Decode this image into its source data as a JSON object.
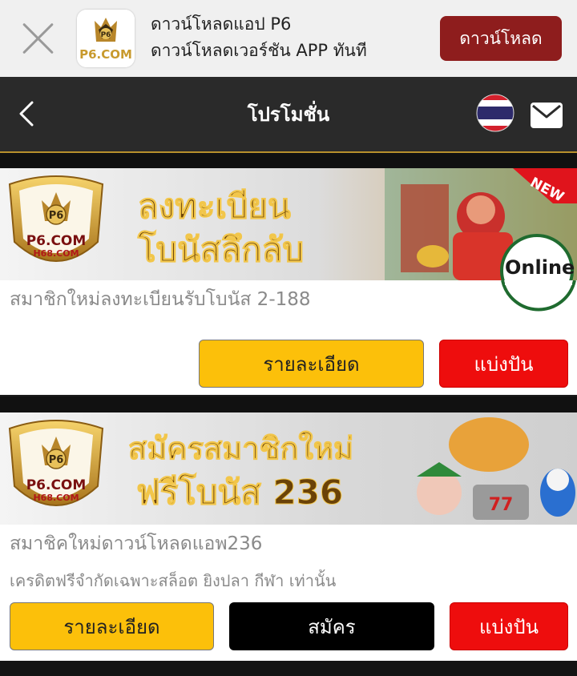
{
  "download_bar": {
    "line1": "ดาวน์โหลดแอป P6",
    "line2": "ดาวน์โหลดเวอร์ชัน APP ทันที",
    "button": "ดาวน์โหลด",
    "logo_text": "P6.COM"
  },
  "header": {
    "title": "โปรโมชั่น"
  },
  "promotions": [
    {
      "banner_headline_1": "ลงทะเบียน",
      "banner_headline_2": "โบนัสลึกลับ",
      "badge_new": "NEW",
      "badge_online": "Online",
      "brand_1": "P6.COM",
      "brand_2": "H68.COM",
      "title": "สมาชิกใหม่ลงทะเบียนรับโบนัส 2-188",
      "details_button": "รายละเอียด",
      "share_button": "แบ่งปัน"
    },
    {
      "banner_headline_1": "สมัครสมาชิกใหม่",
      "banner_headline_2": "ฟรีโบนัส 236",
      "brand_1": "P6.COM",
      "brand_2": "H68.COM",
      "title": "สมาชิคใหม่ดาวน์โหลดแอพ236",
      "subtitle": "เครดิตฟรีจำกัดเฉพาะสล็อต ยิงปลา กีฬา เท่านั้น",
      "details_button": "รายละเอียด",
      "register_button": "สมัคร",
      "share_button": "แบ่งปัน"
    }
  ],
  "colors": {
    "accent_gold": "#fcc00a",
    "share_red": "#ee0d0d",
    "download_button": "#8e1d1d",
    "header_bg": "#2a2a2a"
  },
  "icons": [
    "close-icon",
    "app-logo-icon",
    "back-arrow-icon",
    "thai-flag-icon",
    "mail-icon"
  ]
}
